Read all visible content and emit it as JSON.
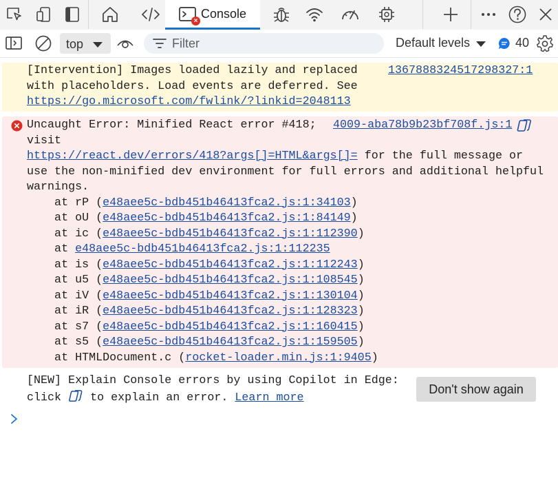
{
  "tabbar": {
    "tabs": [
      {
        "name": "device-emulation",
        "icon": "device-emulation-icon"
      },
      {
        "name": "inspect",
        "icon": "inspect-icon"
      },
      {
        "name": "dock-sidebar",
        "icon": "dock-icon"
      },
      {
        "name": "welcome",
        "icon": "home-icon"
      },
      {
        "name": "elements",
        "icon": "code-icon"
      },
      {
        "name": "sources",
        "icon": "bug-icon"
      },
      {
        "name": "network",
        "icon": "wifi-icon"
      },
      {
        "name": "performance",
        "icon": "gauge-icon"
      },
      {
        "name": "memory",
        "icon": "chip-icon"
      }
    ],
    "active_tab_label": "Console",
    "active_tab_error_badge": "×",
    "add_tab_icon": "plus-icon",
    "more_icon": "ellipsis-icon",
    "help_icon": "help-icon",
    "close_icon": "close-icon"
  },
  "toolbar": {
    "context_value": "top",
    "filter_placeholder": "Filter",
    "levels_label": "Default levels",
    "message_count": "40"
  },
  "console": {
    "intervention": {
      "lines": [
        "[Intervention] Images loaded lazily and replaced",
        "with placeholders. Load events are deferred. See"
      ],
      "link": "https://go.microsoft.com/fwlink/?linkid=2048113",
      "source": "1367888324517298327:1"
    },
    "error": {
      "line1": "Uncaught Error: Minified React error #418;",
      "line2": "visit",
      "link": "https://react.dev/errors/418?args[]=HTML&args[]=",
      "after_link": " for the full message or",
      "line4": "use the non-minified dev environment for full errors and additional helpful",
      "line5": "warnings.",
      "source": "4009-aba78b9b23bf708f.js:1",
      "stack": [
        {
          "prefix": "    at rP (",
          "loc": "e48aee5c-bdb451b46413fca2.js:1:34103",
          "suffix": ")"
        },
        {
          "prefix": "    at oU (",
          "loc": "e48aee5c-bdb451b46413fca2.js:1:84149",
          "suffix": ")"
        },
        {
          "prefix": "    at ic (",
          "loc": "e48aee5c-bdb451b46413fca2.js:1:112390",
          "suffix": ")"
        },
        {
          "prefix": "    at ",
          "loc": "e48aee5c-bdb451b46413fca2.js:1:112235",
          "suffix": ""
        },
        {
          "prefix": "    at is (",
          "loc": "e48aee5c-bdb451b46413fca2.js:1:112243",
          "suffix": ")"
        },
        {
          "prefix": "    at u5 (",
          "loc": "e48aee5c-bdb451b46413fca2.js:1:108545",
          "suffix": ")"
        },
        {
          "prefix": "    at iV (",
          "loc": "e48aee5c-bdb451b46413fca2.js:1:130104",
          "suffix": ")"
        },
        {
          "prefix": "    at iR (",
          "loc": "e48aee5c-bdb451b46413fca2.js:1:128323",
          "suffix": ")"
        },
        {
          "prefix": "    at s7 (",
          "loc": "e48aee5c-bdb451b46413fca2.js:1:160415",
          "suffix": ")"
        },
        {
          "prefix": "    at s5 (",
          "loc": "e48aee5c-bdb451b46413fca2.js:1:159505",
          "suffix": ")"
        },
        {
          "prefix": "    at HTMLDocument.c (",
          "loc": "rocket-loader.min.js:1:9405",
          "suffix": ")"
        }
      ]
    },
    "copilot_tip": {
      "line1": "[NEW] Explain Console errors by using Copilot in Edge:",
      "line2_start": "click ",
      "line2_mid": " to explain an error. ",
      "learn_more": "Learn more",
      "dismiss_label": "Don't show again"
    }
  }
}
